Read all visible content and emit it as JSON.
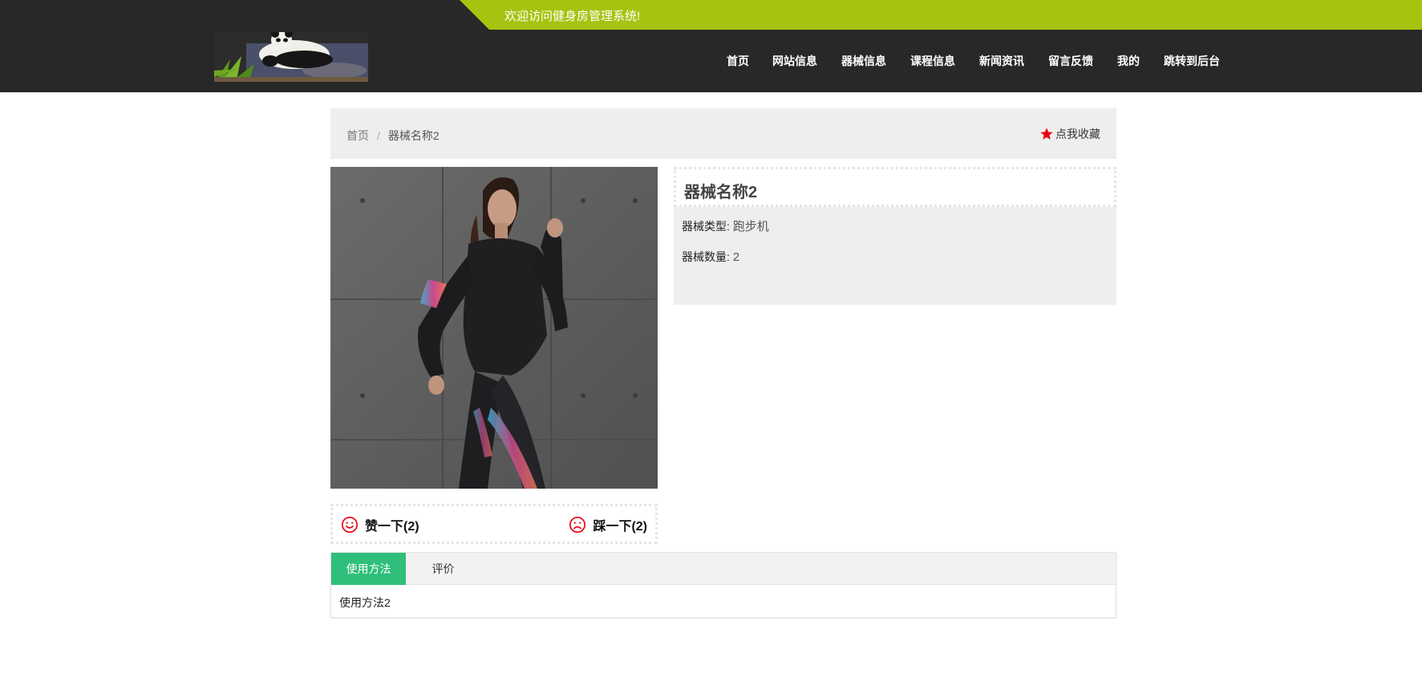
{
  "header": {
    "welcome": "欢迎访问健身房管理系统!",
    "nav": [
      "首页",
      "网站信息",
      "器械信息",
      "课程信息",
      "新闻资讯",
      "留言反馈",
      "我的",
      "跳转到后台"
    ]
  },
  "breadcrumb": {
    "home": "首页",
    "separator": "/",
    "current": "器械名称2"
  },
  "favorite": {
    "label": "点我收藏"
  },
  "product": {
    "title": "器械名称2",
    "type_label": "器械类型:",
    "type_value": "跑步机",
    "count_label": "器械数量:",
    "count_value": "2"
  },
  "votes": {
    "like_label": "赞一下(2)",
    "dislike_label": "踩一下(2)"
  },
  "tabs": {
    "items": [
      "使用方法",
      "评价"
    ],
    "active_content": "使用方法2"
  },
  "colors": {
    "header_bg": "#282828",
    "accent_green": "#a6c30f",
    "tab_active": "#2fbf7a",
    "star": "#e60012"
  }
}
